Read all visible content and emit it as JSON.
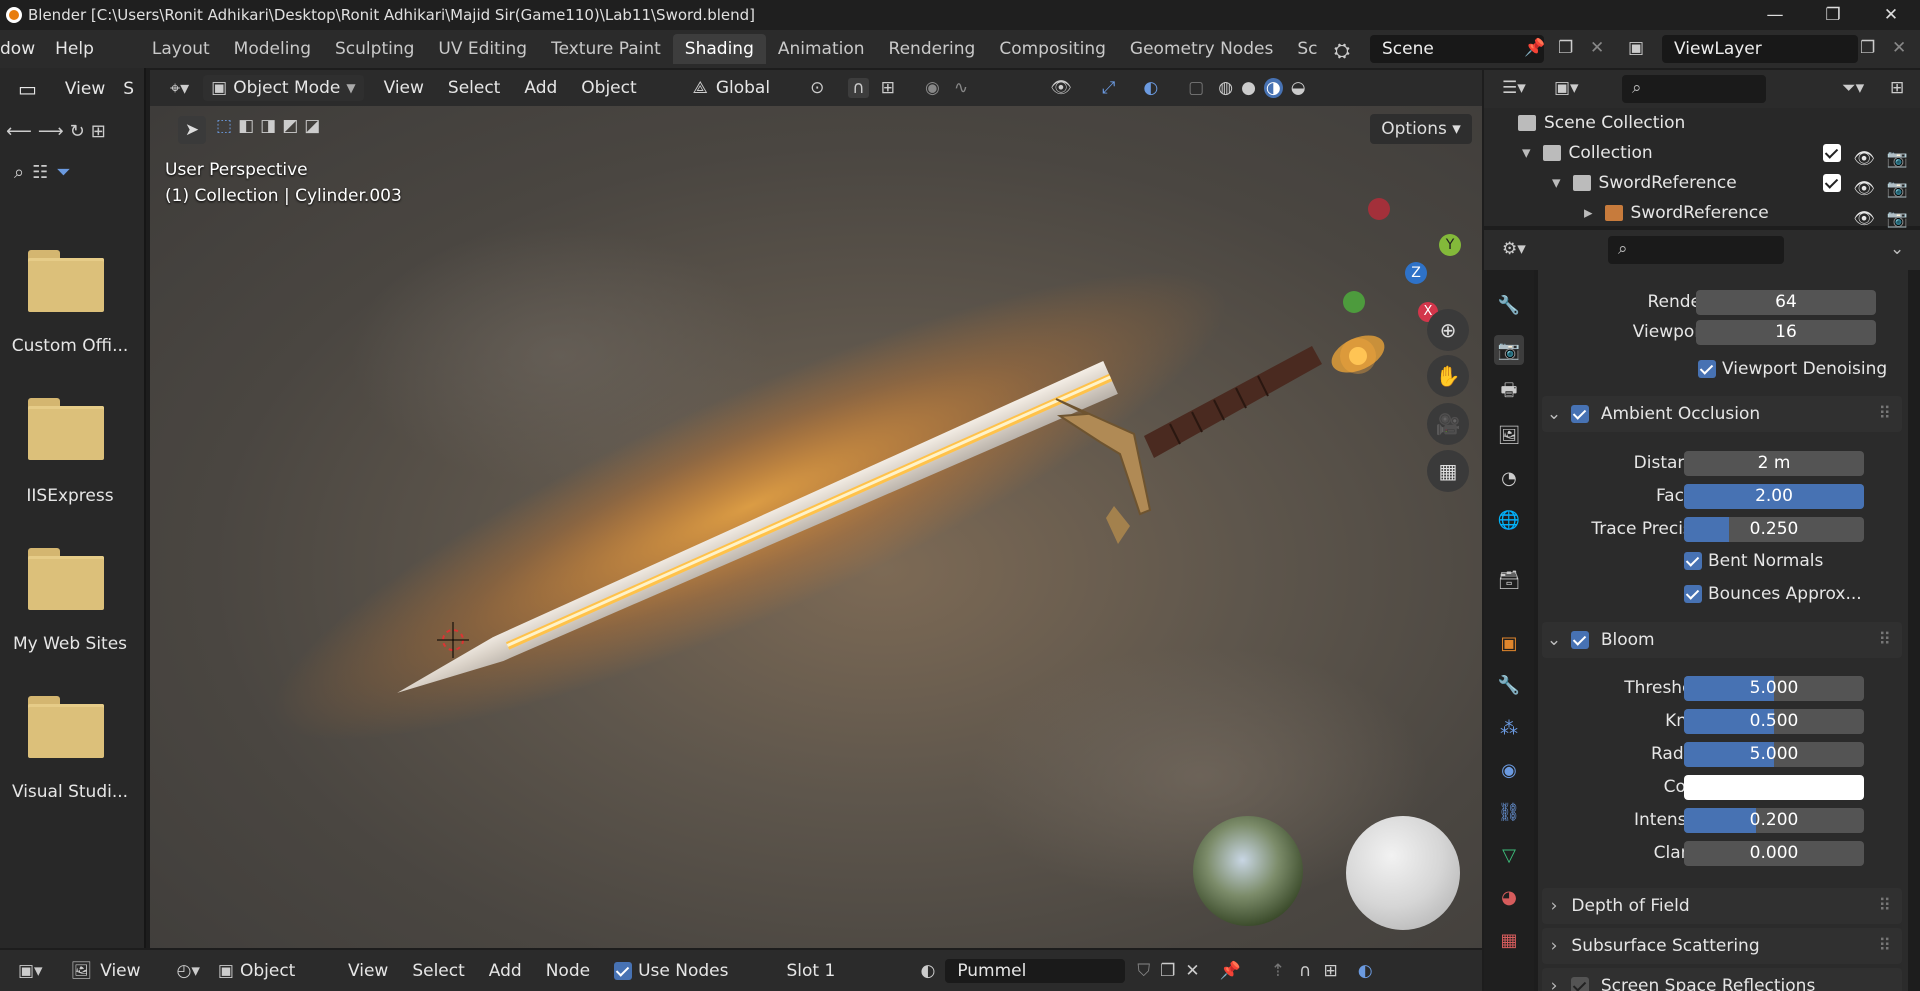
{
  "titlebar": {
    "title": "Blender [C:\\Users\\Ronit Adhikari\\Desktop\\Ronit Adhikari\\Majid Sir(Game110)\\Lab11\\Sword.blend]",
    "minimize": "—",
    "maximize": "❐",
    "close": "✕"
  },
  "menubar": {
    "menus": [
      "dow",
      "Help"
    ],
    "workspaces": [
      "Layout",
      "Modeling",
      "Sculpting",
      "UV Editing",
      "Texture Paint",
      "Shading",
      "Animation",
      "Rendering",
      "Compositing",
      "Geometry Nodes",
      "Sc"
    ],
    "active_workspace": "Shading",
    "scene": "Scene",
    "view_layer": "ViewLayer"
  },
  "file_browser": {
    "view_label": "View",
    "extra_label": "S",
    "folders": [
      "Custom Offi...",
      "IISExpress",
      "My Web Sites",
      "Visual Studi..."
    ]
  },
  "viewport": {
    "mode": "Object Mode",
    "menus": [
      "View",
      "Select",
      "Add",
      "Object"
    ],
    "orientation": "Global",
    "options": "Options",
    "perspective": "User Perspective",
    "object_info": "(1) Collection | Cylinder.003",
    "gizmo": {
      "y": "Y",
      "z": "Z",
      "x": "X"
    }
  },
  "node_header": {
    "view_label": "View",
    "editor": "Object",
    "menus": [
      "View",
      "Select",
      "Add",
      "Node"
    ],
    "use_nodes": "Use Nodes",
    "slot": "Slot 1",
    "material": "Pummel"
  },
  "outliner": {
    "rows": [
      {
        "label": "Scene Collection",
        "indent": 0
      },
      {
        "label": "Collection",
        "indent": 1
      },
      {
        "label": "SwordReference",
        "indent": 2
      },
      {
        "label": "SwordReference",
        "indent": 3
      }
    ]
  },
  "properties": {
    "samples": [
      {
        "label": "Render",
        "value": "64"
      },
      {
        "label": "Viewport",
        "value": "16"
      }
    ],
    "viewport_denoising": "Viewport Denoising",
    "ambient_occlusion": {
      "title": "Ambient Occlusion",
      "distance": {
        "label": "Distance",
        "value": "2 m",
        "fill": 0
      },
      "factor": {
        "label": "Factor",
        "value": "2.00",
        "fill": 1.0
      },
      "trace": {
        "label": "Trace Precis...",
        "value": "0.250",
        "fill": 0.25
      },
      "bent_normals": "Bent Normals",
      "bounces": "Bounces Approx..."
    },
    "bloom": {
      "title": "Bloom",
      "threshold": {
        "label": "Threshold",
        "value": "5.000",
        "fill": 0.5
      },
      "knee": {
        "label": "Knee",
        "value": "0.500",
        "fill": 0.5
      },
      "radius": {
        "label": "Radius",
        "value": "5.000",
        "fill": 0.5
      },
      "color_label": "Color",
      "intensity": {
        "label": "Intensity",
        "value": "0.200",
        "fill": 0.4
      },
      "clamp": {
        "label": "Clamp",
        "value": "0.000",
        "fill": 0
      }
    },
    "collapsed_panels": [
      "Depth of Field",
      "Subsurface Scattering",
      "Screen Space Reflections"
    ]
  },
  "colors": {
    "accent": "#4772b3",
    "active_tab": "#3d3d3d"
  }
}
